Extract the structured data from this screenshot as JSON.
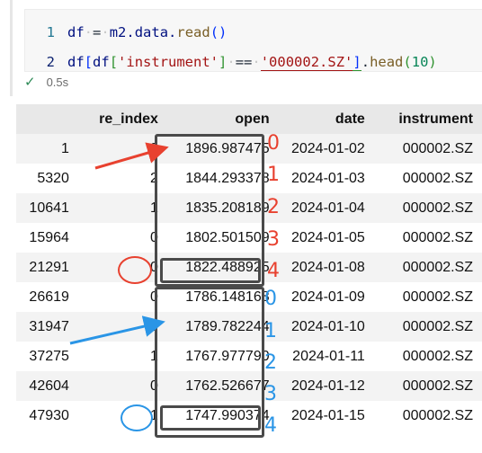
{
  "code": {
    "line_numbers": [
      "1",
      "2"
    ],
    "line1": {
      "var": "df",
      "eq": "=",
      "obj": "m2.data.",
      "func": "read",
      "parens": "()"
    },
    "line2": {
      "var1": "df",
      "var2": "df",
      "key": "'instrument'",
      "op": "==",
      "value": "'000002.SZ'",
      "func": "head",
      "arg": "10"
    }
  },
  "status": {
    "check": "✓",
    "time": "0.5s"
  },
  "table": {
    "columns": [
      "",
      "re_index",
      "open",
      "date",
      "instrument"
    ],
    "rows": [
      [
        "1",
        "3",
        "1896.987475",
        "2024-01-02",
        "000002.SZ"
      ],
      [
        "5320",
        "2",
        "1844.293378",
        "2024-01-03",
        "000002.SZ"
      ],
      [
        "10641",
        "1",
        "1835.208189",
        "2024-01-04",
        "000002.SZ"
      ],
      [
        "15964",
        "0",
        "1802.501509",
        "2024-01-05",
        "000002.SZ"
      ],
      [
        "21291",
        "0",
        "1822.488925",
        "2024-01-08",
        "000002.SZ"
      ],
      [
        "26619",
        "0",
        "1786.148168",
        "2024-01-09",
        "000002.SZ"
      ],
      [
        "31947",
        "0",
        "1789.782244",
        "2024-01-10",
        "000002.SZ"
      ],
      [
        "37275",
        "1",
        "1767.977790",
        "2024-01-11",
        "000002.SZ"
      ],
      [
        "42604",
        "0",
        "1762.526677",
        "2024-01-12",
        "000002.SZ"
      ],
      [
        "47930",
        "1",
        "1747.990374",
        "2024-01-15",
        "000002.SZ"
      ]
    ]
  },
  "annotations": {
    "red_numbers": [
      "0",
      "1",
      "2",
      "3",
      "4"
    ],
    "blue_numbers": [
      "0",
      "1",
      "2",
      "3",
      "4"
    ],
    "colors": {
      "red": "#e8412f",
      "blue": "#2a95e6",
      "box": "#4a4a4a"
    }
  }
}
